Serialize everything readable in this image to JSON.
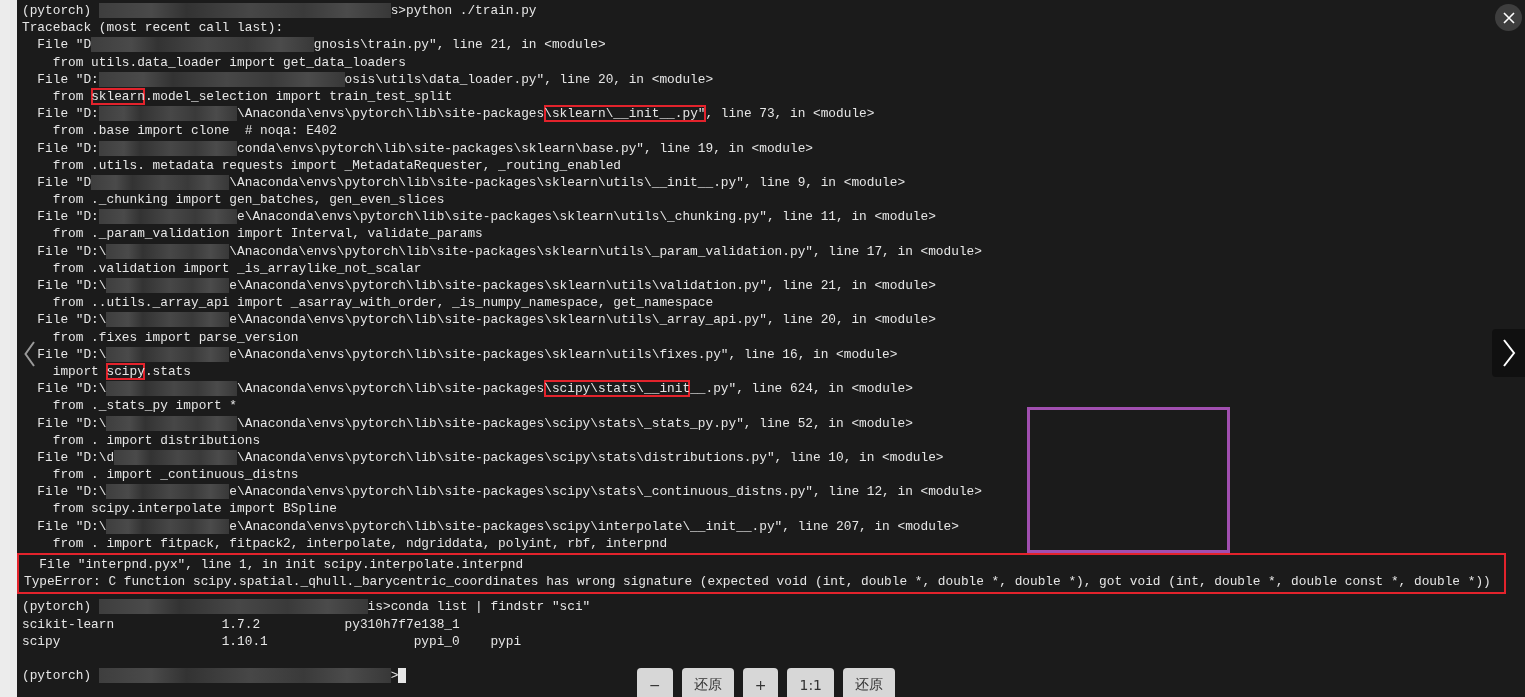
{
  "viewer": {
    "toolbar": [
      {
        "label": "−"
      },
      {
        "label": "还原"
      },
      {
        "label": "+"
      },
      {
        "label": "1:1"
      },
      {
        "label": "还原"
      }
    ],
    "annotations": [
      {
        "kind": "outline-box"
      }
    ]
  },
  "terminal": {
    "traceback": [
      {
        "segments": [
          {
            "kind": "text",
            "text": "(pytorch) "
          },
          {
            "kind": "redacted"
          },
          {
            "kind": "text",
            "text": "s>python ./train.py"
          }
        ]
      },
      {
        "segments": [
          {
            "kind": "text",
            "text": "Traceback (most recent call last):"
          }
        ]
      },
      {
        "segments": [
          {
            "kind": "text",
            "text": "  File \"D"
          },
          {
            "kind": "redacted"
          },
          {
            "kind": "text",
            "text": "gnosis\\train.py\", line 21, in <module>"
          }
        ]
      },
      {
        "segments": [
          {
            "kind": "text",
            "text": "    from utils.data_loader import get_data_loaders"
          }
        ]
      },
      {
        "segments": [
          {
            "kind": "text",
            "text": "  File \"D:"
          },
          {
            "kind": "redacted"
          },
          {
            "kind": "text",
            "text": "osis\\utils\\data_loader.py\", line 20, in <module>"
          }
        ]
      },
      {
        "segments": [
          {
            "kind": "text",
            "text": "    from "
          },
          {
            "kind": "text",
            "text": "sklearn",
            "highlighted": true
          },
          {
            "kind": "text",
            "text": ".model_selection import train_test_split"
          }
        ]
      },
      {
        "segments": [
          {
            "kind": "text",
            "text": "  File \"D:"
          },
          {
            "kind": "redacted"
          },
          {
            "kind": "text",
            "text": "\\Anaconda\\envs\\pytorch\\lib\\site-packages"
          },
          {
            "kind": "text",
            "text": "\\sklearn\\__init__.py\"",
            "highlighted": true
          },
          {
            "kind": "text",
            "text": ", line 73, in <module>"
          }
        ]
      },
      {
        "segments": [
          {
            "kind": "text",
            "text": "    from .base import clone  # noqa: E402"
          }
        ]
      },
      {
        "segments": [
          {
            "kind": "text",
            "text": "  File \"D:"
          },
          {
            "kind": "redacted"
          },
          {
            "kind": "text",
            "text": "conda\\envs\\pytorch\\lib\\site-packages\\sklearn\\base.py\", line 19, in <module>"
          }
        ]
      },
      {
        "segments": [
          {
            "kind": "text",
            "text": "    from .utils. metadata requests import _MetadataRequester, _routing_enabled"
          }
        ]
      },
      {
        "segments": [
          {
            "kind": "text",
            "text": "  File \"D"
          },
          {
            "kind": "redacted"
          },
          {
            "kind": "text",
            "text": "\\Anaconda\\envs\\pytorch\\lib\\site-packages\\sklearn\\utils\\__init__.py\", line 9, in <module>"
          }
        ]
      },
      {
        "segments": [
          {
            "kind": "text",
            "text": "    from ._chunking import gen_batches, gen_even_slices"
          }
        ]
      },
      {
        "segments": [
          {
            "kind": "text",
            "text": "  File \"D:"
          },
          {
            "kind": "redacted"
          },
          {
            "kind": "text",
            "text": "e\\Anaconda\\envs\\pytorch\\lib\\site-packages\\sklearn\\utils\\_chunking.py\", line 11, in <module>"
          }
        ]
      },
      {
        "segments": [
          {
            "kind": "text",
            "text": "    from ._param_validation import Interval, validate_params"
          }
        ]
      },
      {
        "segments": [
          {
            "kind": "text",
            "text": "  File \"D:\\"
          },
          {
            "kind": "redacted"
          },
          {
            "kind": "text",
            "text": "\\Anaconda\\envs\\pytorch\\lib\\site-packages\\sklearn\\utils\\_param_validation.py\", line 17, in <module>"
          }
        ]
      },
      {
        "segments": [
          {
            "kind": "text",
            "text": "    from .validation import _is_arraylike_not_scalar"
          }
        ]
      },
      {
        "segments": [
          {
            "kind": "text",
            "text": "  File \"D:\\"
          },
          {
            "kind": "redacted"
          },
          {
            "kind": "text",
            "text": "e\\Anaconda\\envs\\pytorch\\lib\\site-packages\\sklearn\\utils\\validation.py\", line 21, in <module>"
          }
        ]
      },
      {
        "segments": [
          {
            "kind": "text",
            "text": "    from ..utils._array_api import _asarray_with_order, _is_numpy_namespace, get_namespace"
          }
        ]
      },
      {
        "segments": [
          {
            "kind": "text",
            "text": "  File \"D:\\"
          },
          {
            "kind": "redacted"
          },
          {
            "kind": "text",
            "text": "e\\Anaconda\\envs\\pytorch\\lib\\site-packages\\sklearn\\utils\\_array_api.py\", line 20, in <module>"
          }
        ]
      },
      {
        "segments": [
          {
            "kind": "text",
            "text": "    from .fixes import parse_version"
          }
        ]
      },
      {
        "segments": [
          {
            "kind": "text",
            "text": "  File \"D:\\"
          },
          {
            "kind": "redacted"
          },
          {
            "kind": "text",
            "text": "e\\Anaconda\\envs\\pytorch\\lib\\site-packages\\sklearn\\utils\\fixes.py\", line 16, in <module>"
          }
        ]
      },
      {
        "segments": [
          {
            "kind": "text",
            "text": "    import "
          },
          {
            "kind": "text",
            "text": "scipy",
            "highlighted": true
          },
          {
            "kind": "text",
            "text": ".stats"
          }
        ]
      },
      {
        "segments": [
          {
            "kind": "text",
            "text": "  File \"D:\\"
          },
          {
            "kind": "redacted"
          },
          {
            "kind": "text",
            "text": "\\Anaconda\\envs\\pytorch\\lib\\site-packages"
          },
          {
            "kind": "text",
            "text": "\\scipy\\stats\\__init",
            "highlighted": true
          },
          {
            "kind": "text",
            "text": "__.py\", line 624, in <module>"
          }
        ]
      },
      {
        "segments": [
          {
            "kind": "text",
            "text": "    from ._stats_py import *"
          }
        ]
      },
      {
        "segments": [
          {
            "kind": "text",
            "text": "  File \"D:\\"
          },
          {
            "kind": "redacted"
          },
          {
            "kind": "text",
            "text": "\\Anaconda\\envs\\pytorch\\lib\\site-packages\\scipy\\stats\\_stats_py.py\", line 52, in <module>"
          }
        ]
      },
      {
        "segments": [
          {
            "kind": "text",
            "text": "    from . import distributions"
          }
        ]
      },
      {
        "segments": [
          {
            "kind": "text",
            "text": "  File \"D:\\d"
          },
          {
            "kind": "redacted"
          },
          {
            "kind": "text",
            "text": "\\Anaconda\\envs\\pytorch\\lib\\site-packages\\scipy\\stats\\distributions.py\", line 10, in <module>"
          }
        ]
      },
      {
        "segments": [
          {
            "kind": "text",
            "text": "    from . import _continuous_distns"
          }
        ]
      },
      {
        "segments": [
          {
            "kind": "text",
            "text": "  File \"D:\\"
          },
          {
            "kind": "redacted"
          },
          {
            "kind": "text",
            "text": "e\\Anaconda\\envs\\pytorch\\lib\\site-packages\\scipy\\stats\\_continuous_distns.py\", line 12, in <module>"
          }
        ]
      },
      {
        "segments": [
          {
            "kind": "text",
            "text": "    from scipy.interpolate import BSpline"
          }
        ]
      },
      {
        "segments": [
          {
            "kind": "text",
            "text": "  File \"D:\\"
          },
          {
            "kind": "redacted"
          },
          {
            "kind": "text",
            "text": "e\\Anaconda\\envs\\pytorch\\lib\\site-packages\\scipy\\interpolate\\__init__.py\", line 207, in <module>"
          }
        ]
      },
      {
        "segments": [
          {
            "kind": "text",
            "text": "    from . import fitpack, fitpack2, interpolate, ndgriddata, polyint, rbf, interpnd"
          }
        ]
      }
    ],
    "error": {
      "highlighted": true,
      "lines": [
        {
          "segments": [
            {
              "kind": "text",
              "text": "  File \"interpnd.pyx\", line 1, in init scipy.interpolate.interpnd"
            }
          ]
        },
        {
          "segments": [
            {
              "kind": "text",
              "text": "TypeError: C function scipy.spatial._qhull._barycentric_coordinates has wrong signature (expected void (int, double *, double *, double *), got void (int, double *, double const *, double *))"
            }
          ]
        }
      ]
    },
    "after": [
      {
        "segments": [
          {
            "kind": "text",
            "text": "(pytorch) "
          },
          {
            "kind": "redacted"
          },
          {
            "kind": "text",
            "text": "is>conda list | findstr \"sci\""
          }
        ]
      },
      {
        "segments": [
          {
            "kind": "text",
            "text": "scikit-learn              1.7.2           py310h7f7e138_1"
          }
        ]
      },
      {
        "segments": [
          {
            "kind": "text",
            "text": "scipy                     1.10.1                   pypi_0    pypi"
          }
        ]
      },
      {
        "segments": [
          {
            "kind": "text",
            "text": "(pytorch) "
          },
          {
            "kind": "redacted"
          },
          {
            "kind": "text",
            "text": ">"
          }
        ],
        "cursor": true
      }
    ]
  }
}
